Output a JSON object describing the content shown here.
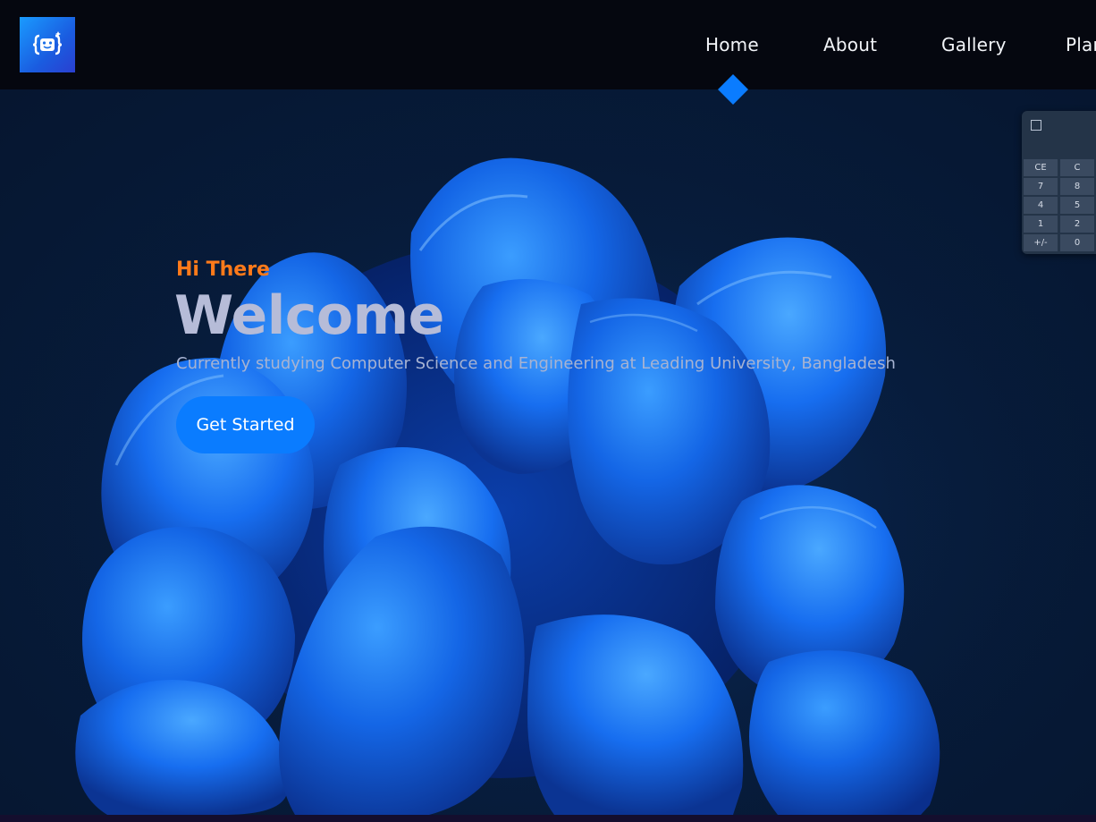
{
  "nav": {
    "items": [
      {
        "label": "Home",
        "active": true
      },
      {
        "label": "About"
      },
      {
        "label": "Gallery"
      },
      {
        "label": "Plar"
      }
    ]
  },
  "hero": {
    "greeting": "Hi There",
    "title": "Welcome",
    "subtitle": "Currently studying Computer Science and Engineering at Leading University, Bangladesh",
    "cta_label": "Get Started"
  },
  "calculator": {
    "keys": [
      "CE",
      "C",
      "7",
      "8",
      "4",
      "5",
      "1",
      "2",
      "+/-",
      "0"
    ]
  },
  "colors": {
    "accent": "#0a7cff",
    "greeting": "#ff7a1a",
    "header_bg": "#05070f",
    "hero_bg": "#061a33"
  },
  "icons": {
    "logo": "bot-face-icon",
    "active_indicator": "diamond-icon",
    "calculator": "calculator-icon"
  }
}
